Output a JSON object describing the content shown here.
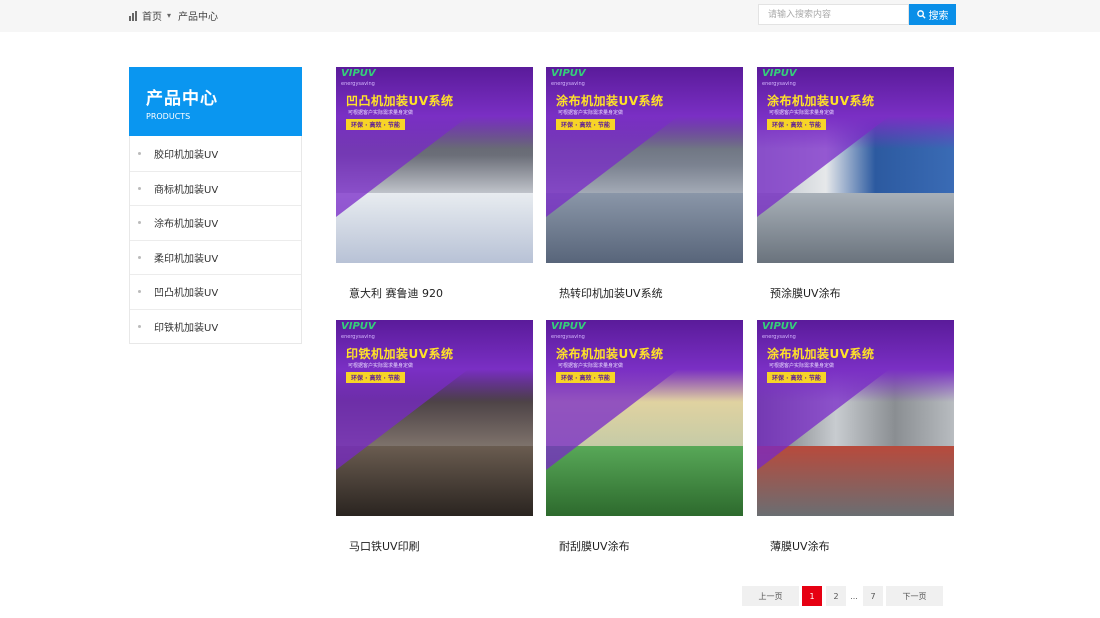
{
  "breadcrumb": {
    "home": "首页",
    "current": "产品中心"
  },
  "search": {
    "placeholder": "请输入搜索内容",
    "button": "搜索"
  },
  "sidebar": {
    "title": "产品中心",
    "subtitle": "PRODUCTS",
    "items": [
      {
        "label": "胶印机加装UV"
      },
      {
        "label": "商标机加装UV"
      },
      {
        "label": "涂布机加装UV"
      },
      {
        "label": "柔印机加装UV"
      },
      {
        "label": "凹凸机加装UV"
      },
      {
        "label": "印铁机加装UV"
      }
    ]
  },
  "products": [
    {
      "caption": "意大利 赛鲁迪 920",
      "banner": "凹凸机加装UV系统",
      "logo": "VIPUV",
      "tagline": "energysaving",
      "slogan": "可根据客户实际需求量身定做",
      "pill": "环保 · 高效 · 节能"
    },
    {
      "caption": "热转印机加装UV系统",
      "banner": "涂布机加装UV系统",
      "logo": "VIPUV",
      "tagline": "energysaving",
      "slogan": "可根据客户实际需求量身定做",
      "pill": "环保 · 高效 · 节能"
    },
    {
      "caption": "预涂膜UV涂布",
      "banner": "涂布机加装UV系统",
      "logo": "VIPUV",
      "tagline": "energysaving",
      "slogan": "可根据客户实际需求量身定做",
      "pill": "环保 · 高效 · 节能"
    },
    {
      "caption": "马口铁UV印刷",
      "banner": "印铁机加装UV系统",
      "logo": "VIPUV",
      "tagline": "energysaving",
      "slogan": "可根据客户实际需求量身定做",
      "pill": "环保 · 高效 · 节能"
    },
    {
      "caption": "耐刮膜UV涂布",
      "banner": "涂布机加装UV系统",
      "logo": "VIPUV",
      "tagline": "energysaving",
      "slogan": "可根据客户实际需求量身定做",
      "pill": "环保 · 高效 · 节能"
    },
    {
      "caption": "薄膜UV涂布",
      "banner": "涂布机加装UV系统",
      "logo": "VIPUV",
      "tagline": "energysaving",
      "slogan": "可根据客户实际需求量身定做",
      "pill": "环保 · 高效 · 节能"
    }
  ],
  "pagination": {
    "prev": "上一页",
    "p1": "1",
    "p2": "2",
    "ellipsis": "...",
    "p7": "7",
    "next": "下一页"
  },
  "colors": {
    "accent": "#0a96f0",
    "search_btn": "#0a8fe8",
    "page_active": "#e60012",
    "banner_purple": "#7a2fc4",
    "banner_text": "#ffe227"
  },
  "icons": {
    "home": "home-icon",
    "search": "search-icon",
    "chevron": "chevron-down-icon"
  }
}
